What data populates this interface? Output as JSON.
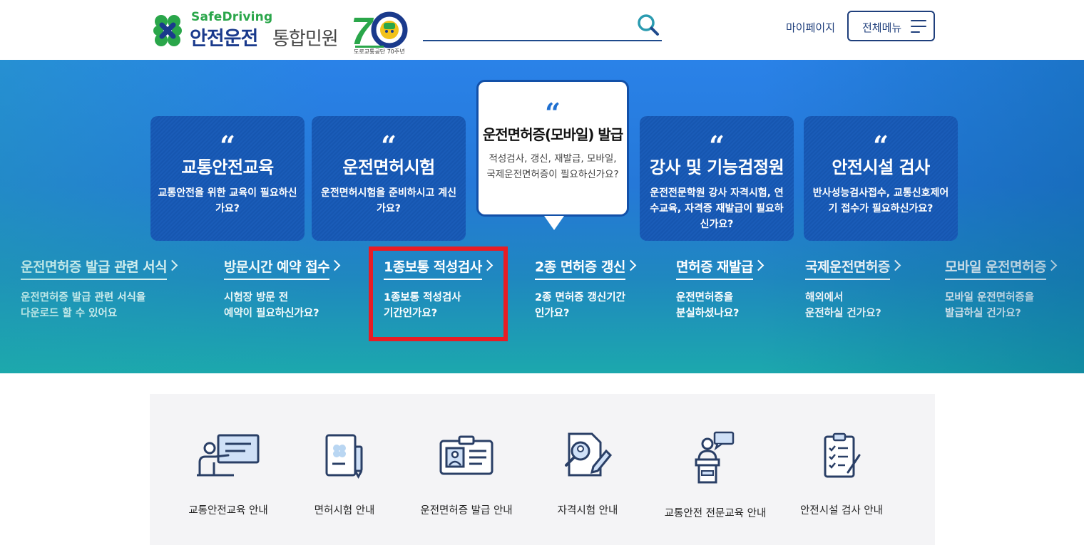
{
  "header": {
    "logo": {
      "sub": "SafeDriving",
      "main": "안전운전",
      "main2": "통합민원",
      "anniversary_number": "70",
      "anniversary_caption": "도로교통공단 70주년"
    },
    "search": {
      "placeholder": "",
      "value": ""
    },
    "mypage_label": "마이페이지",
    "allmenu_label": "전체메뉴"
  },
  "cards": [
    {
      "title": "교통안전교육",
      "desc": "교통안전을 위한 교육이 필요하신가요?"
    },
    {
      "title": "운전면허시험",
      "desc": "운전면허시험을 준비하시고 계신가요?"
    },
    {
      "title": "운전면허증(모바일) 발급",
      "desc": "적성검사, 갱신, 재발급, 모바일, 국제운전면허증이 필요하신가요?",
      "featured": true
    },
    {
      "title": "강사 및 기능검정원",
      "desc": "운전전문학원 강사 자격시험, 연수교육, 자격증 재발급이 필요하신가요?"
    },
    {
      "title": "안전시설 검사",
      "desc": "반사성능검사접수, 교통신호제어기 접수가 필요하신가요?"
    }
  ],
  "quote_mark": "“",
  "links": [
    {
      "title": "운전면허증 발급 관련 서식",
      "desc1": "운전면허증 발급 관련 서식을",
      "desc2": "다운로드 할 수 있어요"
    },
    {
      "title": "방문시간 예약 접수",
      "desc1": "시험장 방문 전",
      "desc2": "예약이 필요하신가요?"
    },
    {
      "title": "1종보통 적성검사",
      "desc1": "1종보통 적성검사",
      "desc2": "기간인가요?",
      "highlighted": true
    },
    {
      "title": "2종 면허증 갱신",
      "desc1": "2종 면허증 갱신기간",
      "desc2": "인가요?"
    },
    {
      "title": "면허증 재발급",
      "desc1": "운전면허증을",
      "desc2": "분실하셨나요?"
    },
    {
      "title": "국제운전면허증",
      "desc1": "해외에서",
      "desc2": "운전하실 건가요?"
    },
    {
      "title": "모바일 운전면허증",
      "desc1": "모바일 운전면허증을",
      "desc2": "발급하실 건가요?"
    }
  ],
  "services": [
    {
      "label": "교통안전교육 안내",
      "icon": "teacher-board-icon"
    },
    {
      "label": "면허시험 안내",
      "icon": "document-pen-icon"
    },
    {
      "label": "운전면허증 발급 안내",
      "icon": "id-card-icon"
    },
    {
      "label": "자격시험 안내",
      "icon": "search-document-icon"
    },
    {
      "label": "교통안전 전문교육 안내",
      "icon": "lecturer-podium-icon"
    },
    {
      "label": "안전시설 검사 안내",
      "icon": "clipboard-checklist-icon"
    }
  ],
  "colors": {
    "brand_navy": "#1a3a8c",
    "brand_green": "#2aa64a",
    "hero_blue": "#2a82e8",
    "card_blue": "#1656b0",
    "highlight_red": "#e81c24"
  }
}
